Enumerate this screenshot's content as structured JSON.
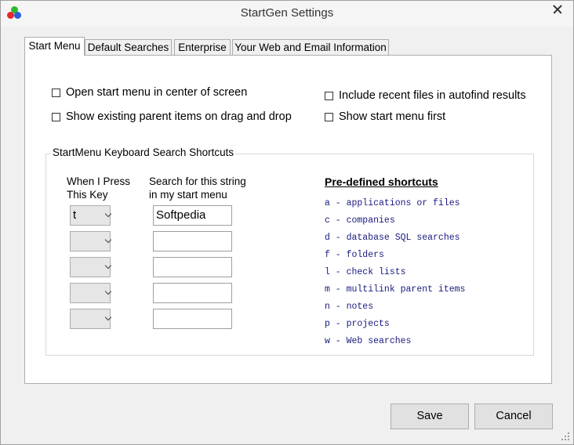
{
  "window": {
    "title": "StartGen Settings",
    "colors": {
      "icon_red": "#e8272a",
      "icon_green": "#2eb82e",
      "icon_blue": "#2a5fd6"
    }
  },
  "tabs": [
    {
      "label": "Start Menu",
      "active": true
    },
    {
      "label": "Default Searches",
      "active": false
    },
    {
      "label": "Enterprise",
      "active": false
    },
    {
      "label": "Your Web and Email Information",
      "active": false
    }
  ],
  "options": {
    "open_center": {
      "label": "Open start menu in center of screen",
      "checked": false
    },
    "show_parent": {
      "label": "Show existing parent items on drag and drop",
      "checked": false
    },
    "include_recent": {
      "label": "Include recent files in autofind results",
      "checked": false
    },
    "show_first": {
      "label": "Show start menu first",
      "checked": false
    }
  },
  "shortcuts_group": {
    "title": "StartMenu Keyboard Search Shortcuts",
    "key_header_1": "When I Press",
    "key_header_2": "This Key",
    "search_header_1": "Search for this string",
    "search_header_2": "in my start menu",
    "rows": [
      {
        "key": "t",
        "search": "Softpedia"
      },
      {
        "key": "",
        "search": ""
      },
      {
        "key": "",
        "search": ""
      },
      {
        "key": "",
        "search": ""
      },
      {
        "key": "",
        "search": ""
      }
    ],
    "predefined_title": "Pre-defined shortcuts",
    "predefined": [
      "a - applications or files",
      "c - companies",
      "d - database SQL searches",
      "f - folders",
      "l - check lists",
      "m - multilink parent items",
      "n - notes",
      "p - projects",
      "w - Web searches"
    ]
  },
  "buttons": {
    "save": "Save",
    "cancel": "Cancel"
  }
}
